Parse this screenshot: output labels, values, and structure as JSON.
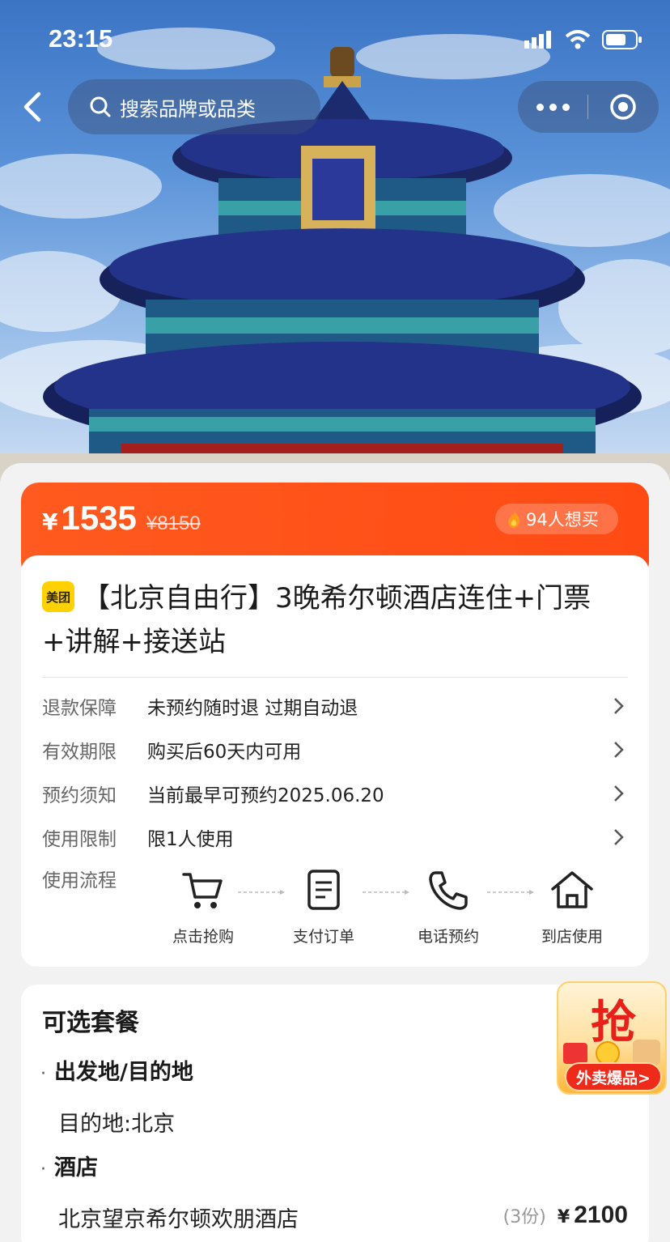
{
  "status": {
    "time": "23:15"
  },
  "nav": {
    "search_placeholder": "搜索品牌或品类"
  },
  "price": {
    "currency": "¥",
    "current": "1535",
    "original": "¥8150",
    "want": "94人想买"
  },
  "product": {
    "brand": "美团",
    "title": "【北京自由行】3晚希尔顿酒店连住+门票+讲解+接送站"
  },
  "info_rows": [
    {
      "key": "退款保障",
      "value": "未预约随时退 过期自动退"
    },
    {
      "key": "有效期限",
      "value": "购买后60天内可用"
    },
    {
      "key": "预约须知",
      "value": "当前最早可预约2025.06.20"
    },
    {
      "key": "使用限制",
      "value": "限1人使用"
    }
  ],
  "flow": {
    "label": "使用流程",
    "steps": [
      {
        "label": "点击抢购",
        "icon": "cart-icon"
      },
      {
        "label": "支付订单",
        "icon": "document-icon"
      },
      {
        "label": "电话预约",
        "icon": "phone-icon"
      },
      {
        "label": "到店使用",
        "icon": "home-icon"
      }
    ]
  },
  "packages": {
    "title": "可选套餐",
    "sections": [
      {
        "heading": "出发地/目的地",
        "item": "目的地:北京"
      },
      {
        "heading": "酒店",
        "item": "北京望京希尔顿欢朋酒店",
        "count": "(3份)",
        "currency": "¥",
        "price": "2100"
      }
    ]
  },
  "ad": {
    "big": "抢",
    "tag": "外卖爆品>"
  },
  "colors": {
    "accent": "#ff4d17",
    "brand_yellow": "#ffd100"
  }
}
